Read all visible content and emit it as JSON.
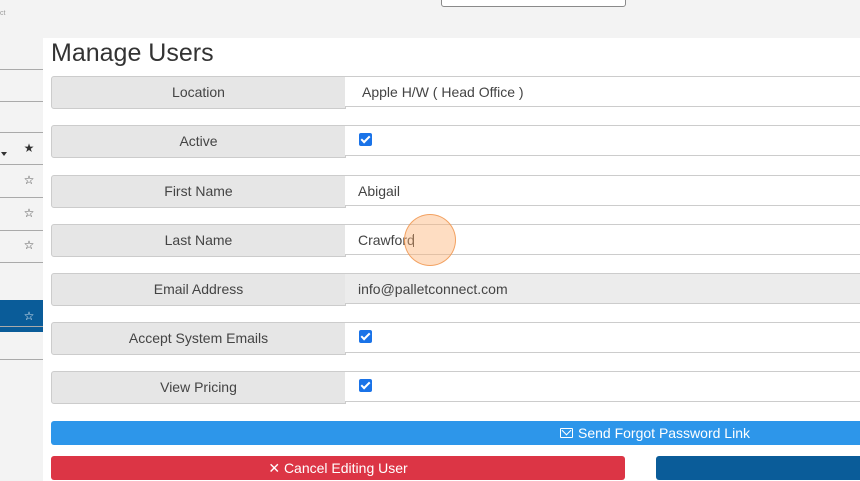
{
  "page": {
    "title": "Manage Users"
  },
  "form": {
    "location": {
      "label": "Location",
      "value": "Apple H/W ( Head Office )"
    },
    "active": {
      "label": "Active",
      "checked": true
    },
    "first_name": {
      "label": "First Name",
      "value": "Abigail"
    },
    "last_name": {
      "label": "Last Name",
      "value": "Crawford"
    },
    "email": {
      "label": "Email Address",
      "value": "info@palletconnect.com"
    },
    "accept_emails": {
      "label": "Accept System Emails",
      "checked": true
    },
    "view_pricing": {
      "label": "View Pricing",
      "checked": true
    }
  },
  "actions": {
    "forgot_password": "Send Forgot Password Link",
    "cancel": "✕ Cancel Editing User"
  },
  "icons": {
    "sidebar_items": [
      "star-filled-icon",
      "star-outline-icon",
      "star-outline-icon",
      "star-outline-icon",
      "star-outline-icon"
    ],
    "forgot_password": "envelope-icon"
  },
  "colors": {
    "primary_blue": "#2d96ea",
    "dark_blue": "#0a5c99",
    "danger_red": "#dc3545",
    "checkbox_blue": "#1a73e8"
  }
}
